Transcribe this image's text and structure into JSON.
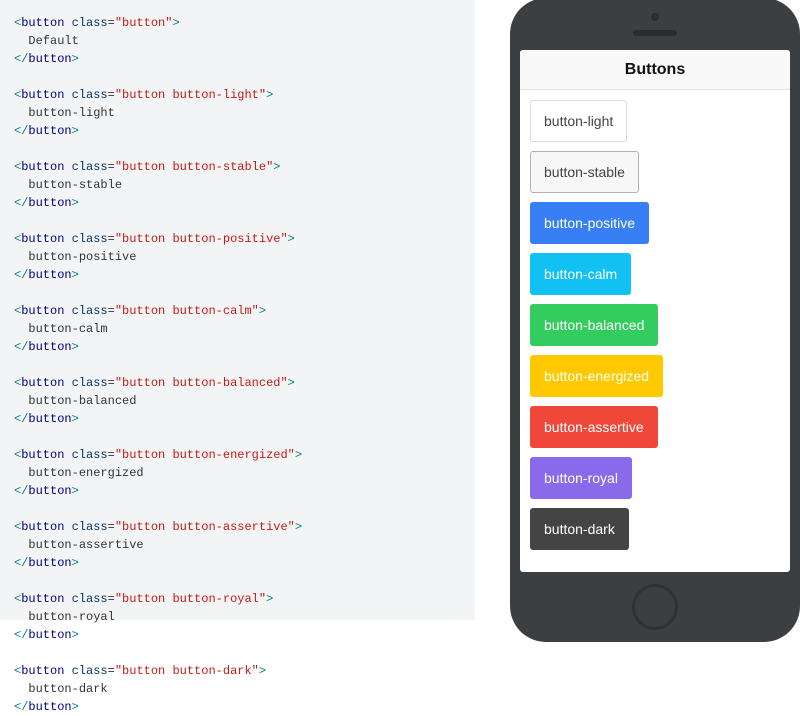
{
  "code_blocks": [
    {
      "class": "button",
      "text": "Default"
    },
    {
      "class": "button button-light",
      "text": "button-light"
    },
    {
      "class": "button button-stable",
      "text": "button-stable"
    },
    {
      "class": "button button-positive",
      "text": "button-positive"
    },
    {
      "class": "button button-calm",
      "text": "button-calm"
    },
    {
      "class": "button button-balanced",
      "text": "button-balanced"
    },
    {
      "class": "button button-energized",
      "text": "button-energized"
    },
    {
      "class": "button button-assertive",
      "text": "button-assertive"
    },
    {
      "class": "button button-royal",
      "text": "button-royal"
    },
    {
      "class": "button button-dark",
      "text": "button-dark"
    }
  ],
  "tag_name": "button",
  "attr_name": "class",
  "open_punc": "<",
  "close_punc": ">",
  "slash": "/",
  "eq": "=",
  "quote": "\"",
  "phone": {
    "header": "Buttons",
    "buttons": [
      {
        "label": "button-light",
        "class": "button-light"
      },
      {
        "label": "button-stable",
        "class": "button-stable"
      },
      {
        "label": "button-positive",
        "class": "button-positive"
      },
      {
        "label": "button-calm",
        "class": "button-calm"
      },
      {
        "label": "button-balanced",
        "class": "button-balanced"
      },
      {
        "label": "button-energized",
        "class": "button-energized"
      },
      {
        "label": "button-assertive",
        "class": "button-assertive"
      },
      {
        "label": "button-royal",
        "class": "button-royal"
      },
      {
        "label": "button-dark",
        "class": "button-dark"
      }
    ]
  }
}
